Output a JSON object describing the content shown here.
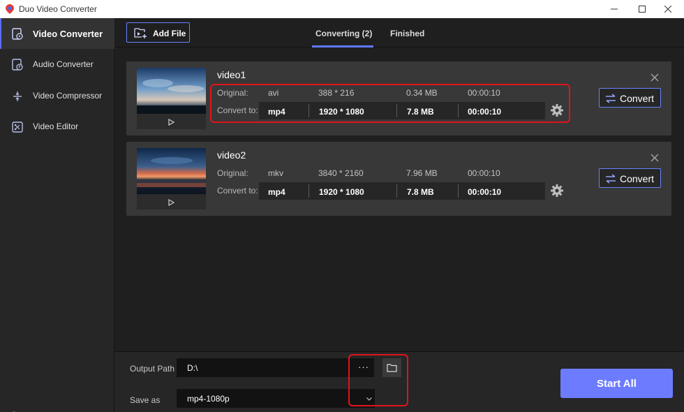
{
  "window": {
    "title": "Duo Video Converter",
    "controls": [
      "minimize-icon",
      "maximize-icon",
      "close-icon"
    ]
  },
  "sidebar": {
    "items": [
      {
        "label": "Video Converter",
        "icon": "video-converter-icon",
        "active": true
      },
      {
        "label": "Audio Converter",
        "icon": "audio-converter-icon",
        "active": false
      },
      {
        "label": "Video Compressor",
        "icon": "video-compressor-icon",
        "active": false
      },
      {
        "label": "Video Editor",
        "icon": "video-editor-icon",
        "active": false
      }
    ],
    "bottom_icons": [
      "info-icon",
      "feedback-icon"
    ]
  },
  "toolbar": {
    "add_file_label": "Add File",
    "tabs": [
      {
        "label": "Converting (2)",
        "active": true
      },
      {
        "label": "Finished",
        "active": false
      }
    ]
  },
  "videos": [
    {
      "name": "video1",
      "original_label": "Original:",
      "convert_to_label": "Convert to:",
      "original": {
        "format": "avi",
        "resolution": "388 * 216",
        "size": "0.34 MB",
        "duration": "00:00:10"
      },
      "target": {
        "format": "mp4",
        "resolution": "1920 * 1080",
        "size": "7.8 MB",
        "duration": "00:00:10"
      },
      "convert_label": "Convert"
    },
    {
      "name": "video2",
      "original_label": "Original:",
      "convert_to_label": "Convert to:",
      "original": {
        "format": "mkv",
        "resolution": "3840 * 2160",
        "size": "7.96 MB",
        "duration": "00:00:10"
      },
      "target": {
        "format": "mp4",
        "resolution": "1920 * 1080",
        "size": "7.8 MB",
        "duration": "00:00:10"
      },
      "convert_label": "Convert"
    }
  ],
  "bottom": {
    "output_path_label": "Output Path",
    "output_path_value": "D:\\",
    "browse_label": "···",
    "save_as_label": "Save as",
    "save_as_value": "mp4-1080p",
    "start_all_label": "Start All"
  },
  "colors": {
    "accent": "#6b83ff",
    "start_button": "#6d7cff",
    "highlight": "#e0141b",
    "background": "#1f1f1f",
    "card": "#383838"
  }
}
